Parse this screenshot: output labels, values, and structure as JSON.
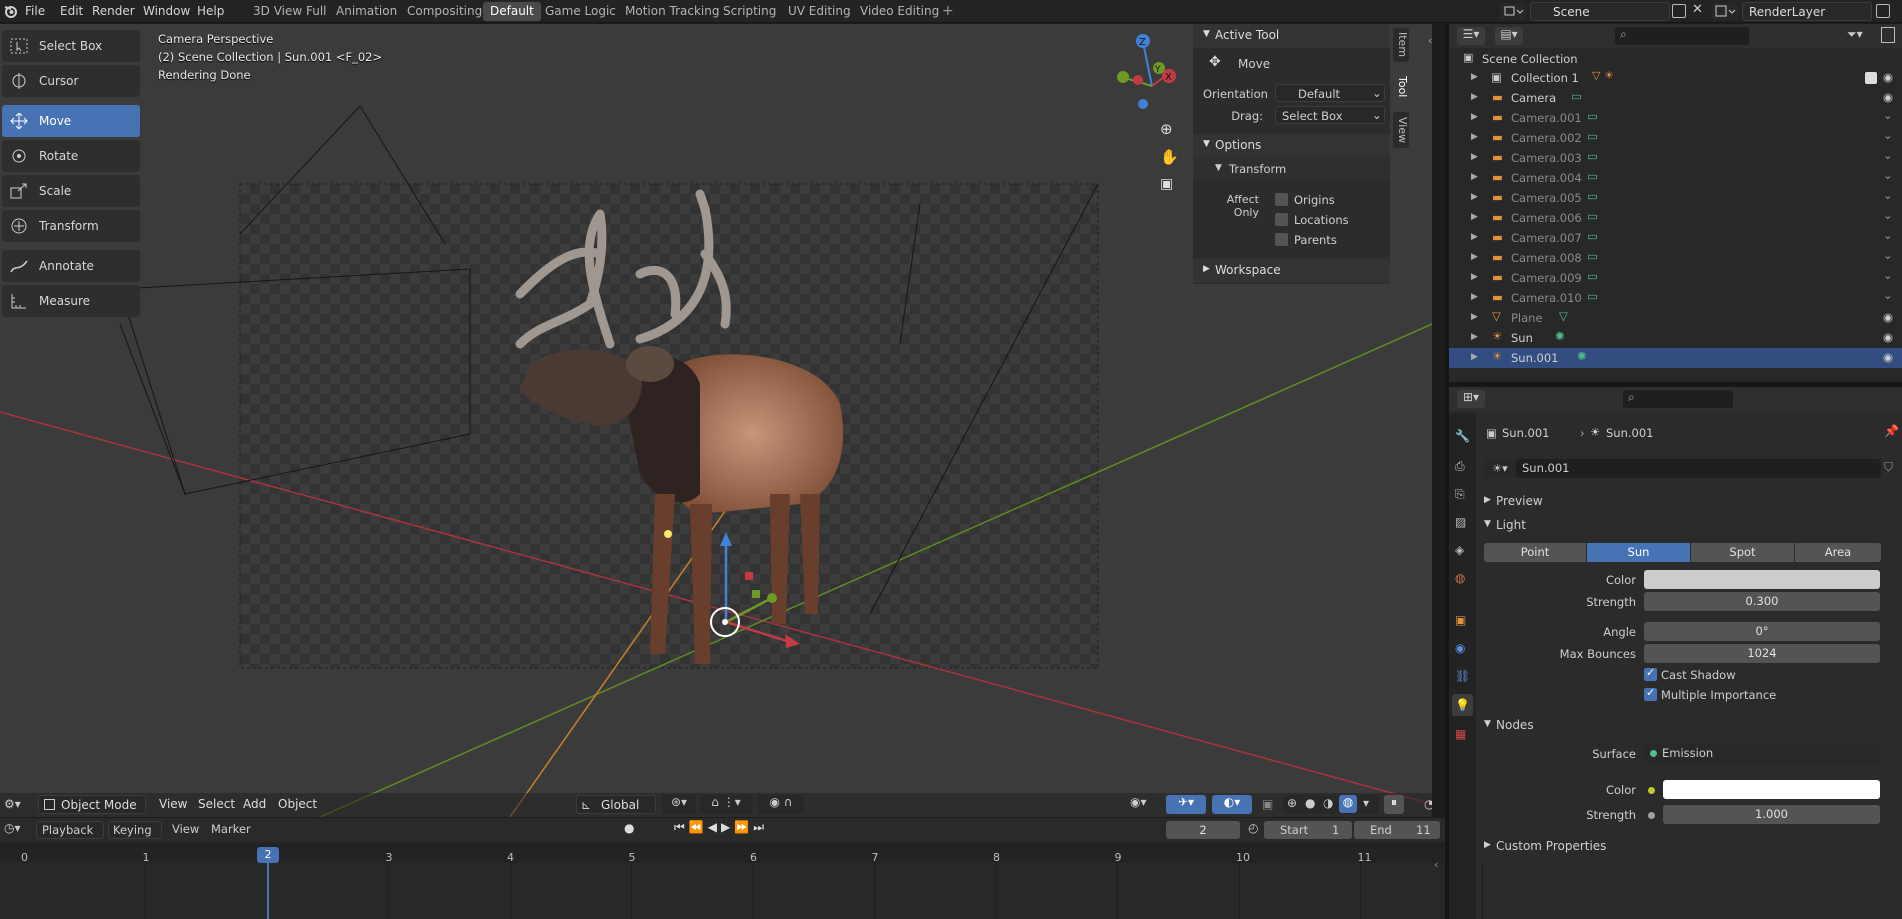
{
  "topbar": {
    "menus": [
      "File",
      "Edit",
      "Render",
      "Window",
      "Help"
    ],
    "workspaces": [
      "3D View Full",
      "Animation",
      "Compositing",
      "Default",
      "Game Logic",
      "Motion Tracking",
      "Scripting",
      "UV Editing",
      "Video Editing"
    ],
    "active_workspace": "Default",
    "scene": "Scene",
    "view_layer": "RenderLayer"
  },
  "tools": [
    {
      "label": "Select Box",
      "icon": "select-box-icon"
    },
    {
      "label": "Cursor",
      "icon": "cursor-icon"
    },
    {
      "label": "Move",
      "icon": "move-icon"
    },
    {
      "label": "Rotate",
      "icon": "rotate-icon"
    },
    {
      "label": "Scale",
      "icon": "scale-icon"
    },
    {
      "label": "Transform",
      "icon": "transform-icon"
    },
    {
      "label": "Annotate",
      "icon": "annotate-icon"
    },
    {
      "label": "Measure",
      "icon": "measure-icon"
    }
  ],
  "viewport": {
    "overlay_line1": "Camera Perspective",
    "overlay_line2": "(2) Scene Collection | Sun.001 <F_02>",
    "overlay_line3": "Rendering Done",
    "mode": "Object Mode",
    "header_menus": [
      "View",
      "Select",
      "Add",
      "Object"
    ],
    "orientation": "Global"
  },
  "npanel": {
    "active_tool_title": "Active Tool",
    "tool_name": "Move",
    "orientation_label": "Orientation",
    "orientation_value": "Default",
    "drag_label": "Drag:",
    "drag_value": "Select Box",
    "options_title": "Options",
    "transform_title": "Transform",
    "affect_only_label": "Affect Only",
    "origins": "Origins",
    "locations": "Locations",
    "parents": "Parents",
    "workspace_title": "Workspace",
    "tabs": [
      "Item",
      "Tool",
      "View"
    ]
  },
  "outliner": {
    "root": "Scene Collection",
    "rows": [
      {
        "name": "Collection 1",
        "dim": false
      },
      {
        "name": "Camera",
        "dim": false
      },
      {
        "name": "Camera.001",
        "dim": true
      },
      {
        "name": "Camera.002",
        "dim": true
      },
      {
        "name": "Camera.003",
        "dim": true
      },
      {
        "name": "Camera.004",
        "dim": true
      },
      {
        "name": "Camera.005",
        "dim": true
      },
      {
        "name": "Camera.006",
        "dim": true
      },
      {
        "name": "Camera.007",
        "dim": true
      },
      {
        "name": "Camera.008",
        "dim": true
      },
      {
        "name": "Camera.009",
        "dim": true
      },
      {
        "name": "Camera.010",
        "dim": true
      },
      {
        "name": "Plane",
        "dim": true
      },
      {
        "name": "Sun",
        "dim": false
      },
      {
        "name": "Sun.001",
        "dim": false,
        "selected": true
      }
    ]
  },
  "properties": {
    "object_name": "Sun.001",
    "data_name": "Sun.001",
    "light_data_field": "Sun.001",
    "preview": "Preview",
    "light": "Light",
    "light_types": [
      "Point",
      "Sun",
      "Spot",
      "Area"
    ],
    "active_light_type": "Sun",
    "color_label": "Color",
    "strength_label": "Strength",
    "strength_value": "0.300",
    "angle_label": "Angle",
    "angle_value": "0°",
    "max_bounces_label": "Max Bounces",
    "max_bounces_value": "1024",
    "cast_shadow": "Cast Shadow",
    "multiple_importance": "Multiple Importance",
    "nodes": "Nodes",
    "surface_label": "Surface",
    "surface_value": "Emission",
    "node_color_label": "Color",
    "node_strength_label": "Strength",
    "node_strength_value": "1.000",
    "custom_properties": "Custom Properties",
    "light_color": "#cccccc",
    "emission_color": "#ffffff"
  },
  "timeline": {
    "menus": [
      "Playback",
      "Keying",
      "View",
      "Marker"
    ],
    "current_frame": "2",
    "start_label": "Start",
    "start": "1",
    "end_label": "End",
    "end": "11",
    "frames": [
      "0",
      "1",
      "2",
      "3",
      "4",
      "5",
      "6",
      "7",
      "8",
      "9",
      "10",
      "11"
    ]
  },
  "colors": {
    "accent": "#4772b3",
    "axis_x": "#c23a44",
    "axis_y": "#6e9a26",
    "outliner_orange": "#e09238",
    "outliner_green": "#4fbf8a"
  }
}
